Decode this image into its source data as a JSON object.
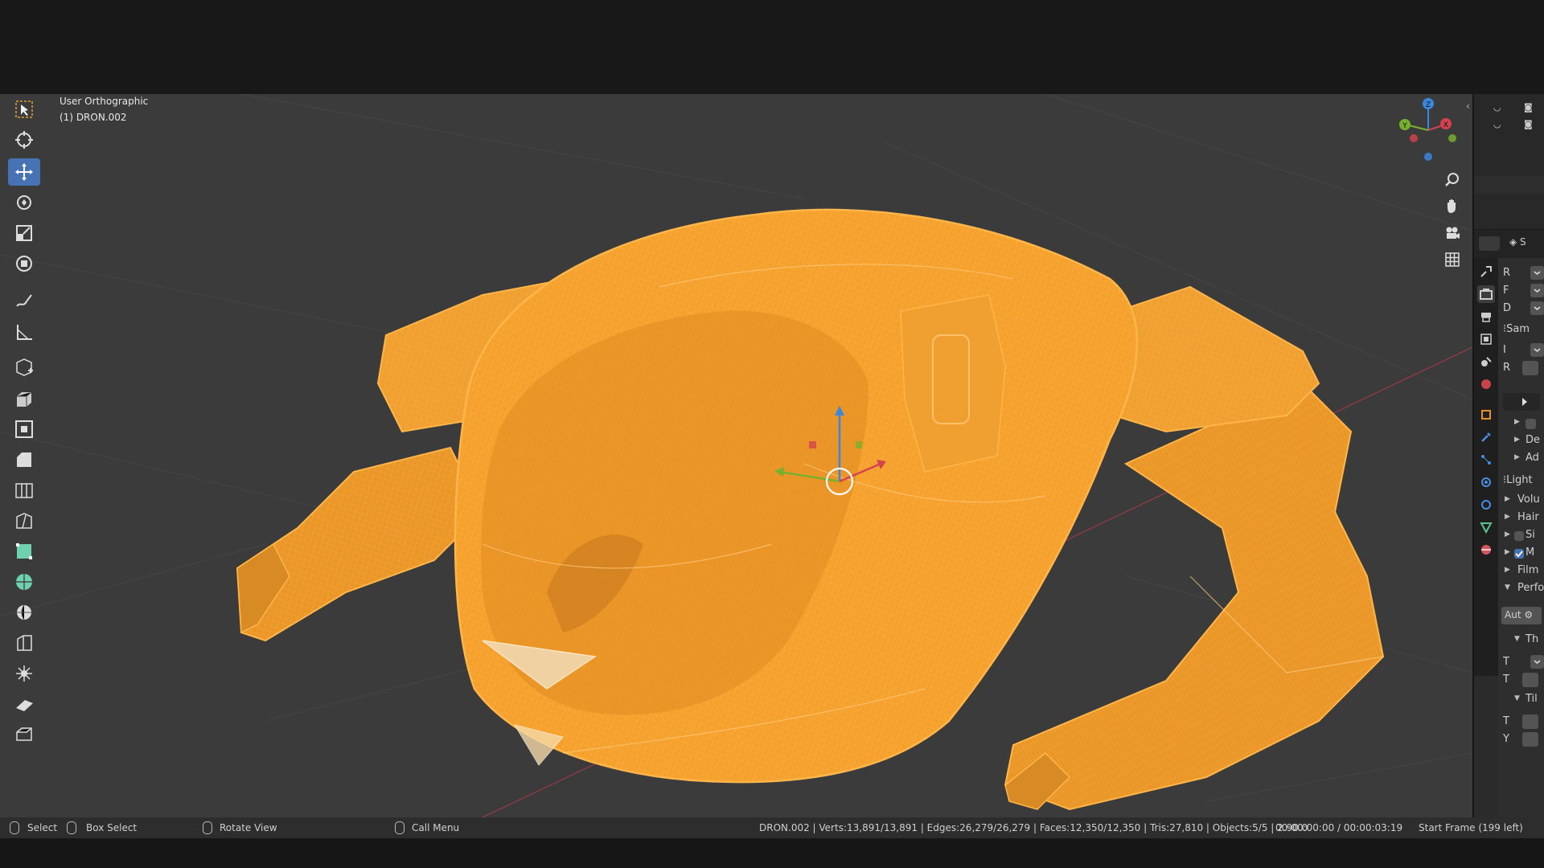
{
  "viewport": {
    "view_name": "User Orthographic",
    "object_name": "(1) DRON.002"
  },
  "toolbar": {
    "tools": [
      {
        "name": "select-box-icon",
        "active": false
      },
      {
        "name": "cursor-icon",
        "active": false
      },
      {
        "name": "move-icon",
        "active": true
      },
      {
        "name": "rotate-icon",
        "active": false
      },
      {
        "name": "scale-icon",
        "active": false
      },
      {
        "name": "transform-icon",
        "active": false
      },
      {
        "name": "annotate-icon",
        "active": false
      },
      {
        "name": "measure-icon",
        "active": false
      },
      {
        "name": "add-cube-icon",
        "active": false
      },
      {
        "name": "extrude-icon",
        "active": false
      },
      {
        "name": "inset-icon",
        "active": false
      },
      {
        "name": "bevel-icon",
        "active": false
      },
      {
        "name": "loop-cut-icon",
        "active": false
      },
      {
        "name": "knife-icon",
        "active": false
      },
      {
        "name": "poly-build-icon",
        "active": false
      },
      {
        "name": "spin-icon",
        "active": false
      },
      {
        "name": "smooth-icon",
        "active": false
      },
      {
        "name": "edge-slide-icon",
        "active": false
      },
      {
        "name": "shrink-fatten-icon",
        "active": false
      },
      {
        "name": "shear-icon",
        "active": false
      },
      {
        "name": "rip-icon",
        "active": false
      }
    ]
  },
  "gizmo": {
    "x": "X",
    "y": "Y",
    "z": "Z"
  },
  "properties": {
    "rows": [
      {
        "kind": "dd",
        "text": "R"
      },
      {
        "kind": "dd",
        "text": "F"
      },
      {
        "kind": "dd",
        "text": "D"
      },
      {
        "kind": "section",
        "text": "Sam"
      },
      {
        "kind": "dd",
        "text": "I"
      },
      {
        "kind": "field",
        "text": "R"
      },
      {
        "kind": "play",
        "text": ""
      },
      {
        "kind": "sub",
        "text": ""
      },
      {
        "kind": "sub",
        "text": "De"
      },
      {
        "kind": "sub",
        "text": "Ad"
      },
      {
        "kind": "section",
        "text": "Light"
      },
      {
        "kind": "panel",
        "text": "Volu"
      },
      {
        "kind": "panel",
        "text": "Hair"
      },
      {
        "kind": "panelchk",
        "text": "Si"
      },
      {
        "kind": "panelchkon",
        "text": "M"
      },
      {
        "kind": "panel",
        "text": "Film"
      },
      {
        "kind": "panelopen",
        "text": "Perfo"
      },
      {
        "kind": "auto",
        "text": "Aut"
      },
      {
        "kind": "subopen",
        "text": "Th"
      },
      {
        "kind": "dd",
        "text": "T"
      },
      {
        "kind": "field",
        "text": "T"
      },
      {
        "kind": "subopen",
        "text": "Til"
      },
      {
        "kind": "field",
        "text": "T"
      },
      {
        "kind": "field",
        "text": "Y"
      }
    ]
  },
  "statusbar": {
    "select": "Select",
    "box_select": "Box Select",
    "rotate_view": "Rotate View",
    "call_menu": "Call Menu",
    "stats": "DRON.002 | Verts:13,891/13,891 | Edges:26,279/26,279 | Faces:12,350/12,350 | Tris:27,810 | Objects:5/5 | 2.90.0",
    "timecode": "00:00:00:00 / 00:00:03:19",
    "frame": "Start Frame (199 left)"
  },
  "colors": {
    "model_fill": "#f59f2a",
    "wire": "#ffb547",
    "viewport_bg": "#3b3b3b",
    "active_tool": "#4772b3",
    "axis_x": "#d4424f",
    "axis_y": "#77b02c",
    "axis_z": "#3a87e0"
  }
}
